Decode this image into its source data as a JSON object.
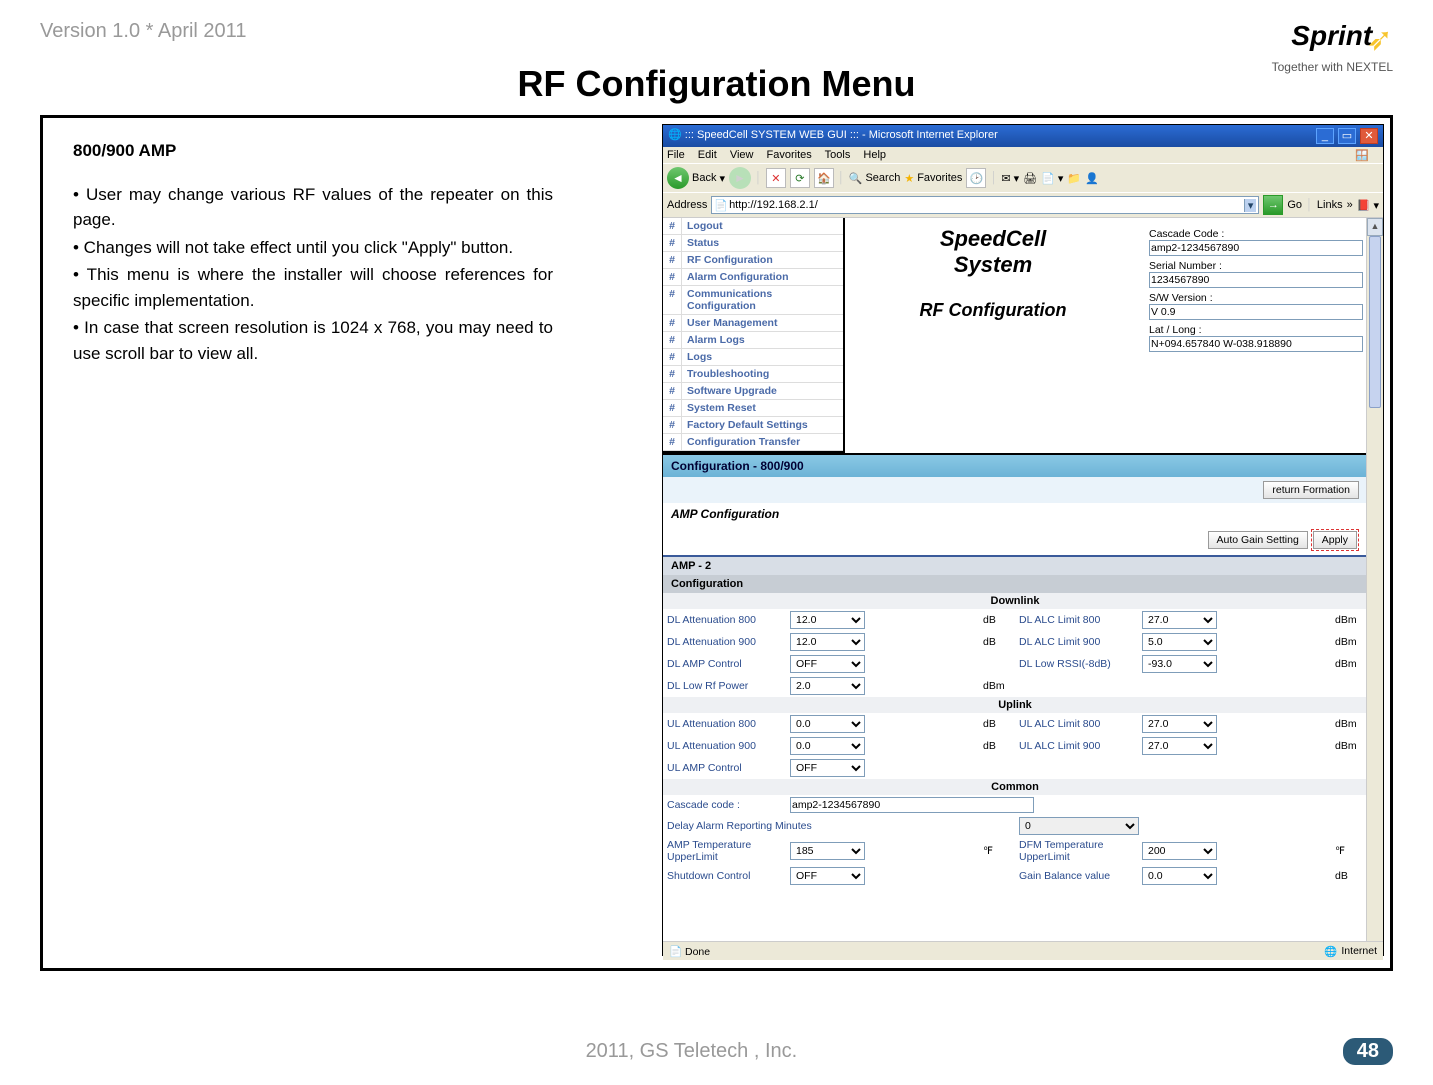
{
  "header": {
    "version": "Version 1.0 * April 2011",
    "logo_name": "Sprint",
    "logo_sub": "Together with NEXTEL"
  },
  "title": "RF Configuration Menu",
  "left": {
    "heading": "800/900 AMP",
    "b1": "• User may change various RF values of the repeater on this page.",
    "b2": "• Changes will not take effect until you click  \"Apply\" button.",
    "b3": "• This menu is where the installer will choose references for specific implementation.",
    "b4": "• In case that screen resolution is 1024 x 768, you may need to use scroll bar to view all."
  },
  "browser": {
    "title": "::: SpeedCell SYSTEM WEB GUI ::: - Microsoft Internet Explorer",
    "menu": {
      "file": "File",
      "edit": "Edit",
      "view": "View",
      "fav": "Favorites",
      "tools": "Tools",
      "help": "Help"
    },
    "toolbar": {
      "back": "Back",
      "search": "Search",
      "fav": "Favorites"
    },
    "address_label": "Address",
    "url": "http://192.168.2.1/",
    "go": "Go",
    "links": "Links",
    "status_done": "Done",
    "status_internet": "Internet"
  },
  "sidebar": {
    "items": [
      {
        "label": "Logout"
      },
      {
        "label": "Status"
      },
      {
        "label": "RF Configuration"
      },
      {
        "label": "Alarm Configuration"
      },
      {
        "label": "Communications Configuration"
      },
      {
        "label": "User Management"
      },
      {
        "label": "Alarm Logs"
      },
      {
        "label": "Logs"
      },
      {
        "label": "Troubleshooting"
      },
      {
        "label": "Software Upgrade"
      },
      {
        "label": "System Reset"
      },
      {
        "label": "Factory Default Settings"
      },
      {
        "label": "Configuration Transfer"
      }
    ]
  },
  "mid": {
    "title1": "SpeedCell",
    "title2": "System",
    "title3": "RF Configuration"
  },
  "info": {
    "cascade_label": "Cascade Code :",
    "cascade_value": "amp2-1234567890",
    "serial_label": "Serial Number :",
    "serial_value": "1234567890",
    "sw_label": "S/W Version :",
    "sw_value": "V 0.9",
    "latlong_label": "Lat / Long :",
    "latlong_value": "N+094.657840 W-038.918890"
  },
  "sections": {
    "config_header": "Configuration - 800/900",
    "return_btn": "return Formation",
    "amp_conf": "AMP Configuration",
    "auto_gain": "Auto Gain Setting",
    "apply": "Apply",
    "amp2": "AMP - 2",
    "configuration": "Configuration",
    "downlink": "Downlink",
    "uplink": "Uplink",
    "common": "Common"
  },
  "dl": {
    "att800_l": "DL Attenuation 800",
    "att800_v": "12.0",
    "att800_u": "dB",
    "att900_l": "DL Attenuation 900",
    "att900_v": "12.0",
    "att900_u": "dB",
    "ampctl_l": "DL AMP Control",
    "ampctl_v": "OFF",
    "lowrf_l": "DL Low Rf Power",
    "lowrf_v": "2.0",
    "lowrf_u": "dBm",
    "alc800_l": "DL ALC Limit 800",
    "alc800_v": "27.0",
    "alc800_u": "dBm",
    "alc900_l": "DL ALC Limit 900",
    "alc900_v": "5.0",
    "alc900_u": "dBm",
    "rssi_l": "DL Low RSSI(-8dB)",
    "rssi_v": "-93.0",
    "rssi_u": "dBm"
  },
  "ul": {
    "att800_l": "UL Attenuation 800",
    "att800_v": "0.0",
    "att800_u": "dB",
    "att900_l": "UL Attenuation 900",
    "att900_v": "0.0",
    "att900_u": "dB",
    "ampctl_l": "UL AMP Control",
    "ampctl_v": "OFF",
    "alc800_l": "UL ALC Limit 800",
    "alc800_v": "27.0",
    "alc800_u": "dBm",
    "alc900_l": "UL ALC Limit 900",
    "alc900_v": "27.0",
    "alc900_u": "dBm"
  },
  "common": {
    "cascade_l": "Cascade code :",
    "cascade_v": "amp2-1234567890",
    "delay_l": "Delay Alarm Reporting Minutes",
    "delay_v": "0",
    "amptemp_l": "AMP Temperature UpperLimit",
    "amptemp_v": "185",
    "amptemp_u": "℉",
    "dfmtemp_l": "DFM Temperature UpperLimit",
    "dfmtemp_v": "200",
    "dfmtemp_u": "℉",
    "shutdown_l": "Shutdown Control",
    "shutdown_v": "OFF",
    "gainbal_l": "Gain Balance value",
    "gainbal_v": "0.0",
    "gainbal_u": "dB"
  },
  "footer": {
    "copyright": "2011, GS Teletech , Inc.",
    "page": "48"
  }
}
